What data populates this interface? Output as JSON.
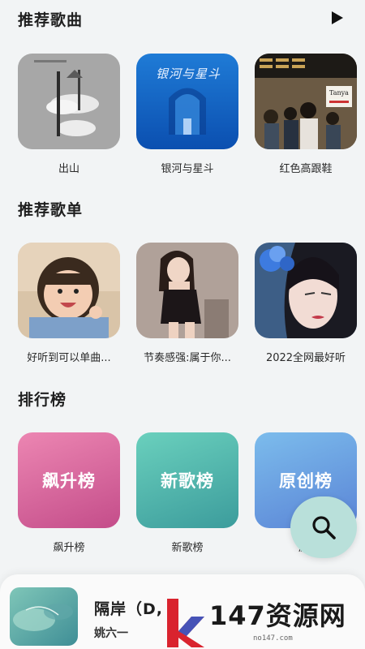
{
  "sections": {
    "songs": {
      "title": "推荐歌曲",
      "items": [
        {
          "label": "出山"
        },
        {
          "label": "银河与星斗",
          "cover_text": "银河与星斗"
        },
        {
          "label": "红色高跟鞋",
          "cover_text": "Tanya"
        }
      ]
    },
    "playlists": {
      "title": "推荐歌单",
      "items": [
        {
          "label": "好听到可以单曲..."
        },
        {
          "label": "节奏感强:属于你..."
        },
        {
          "label": "2022全网最好听"
        }
      ]
    },
    "charts": {
      "title": "排行榜",
      "items": [
        {
          "cover_text": "飙升榜",
          "label": "飙升榜",
          "colors": [
            "#e67aa6",
            "#c94f8c"
          ]
        },
        {
          "cover_text": "新歌榜",
          "label": "新歌榜",
          "colors": [
            "#5fc9b8",
            "#3a9c9a"
          ]
        },
        {
          "cover_text": "原创榜",
          "label": "原",
          "colors": [
            "#74b4e8",
            "#5a86d6"
          ]
        }
      ]
    }
  },
  "icons": {
    "play_all": "play-icon",
    "search": "search-icon"
  },
  "player": {
    "title": "隔岸（D,",
    "artist": "姚六一"
  },
  "watermark": {
    "brand": "147资源网",
    "url": "no147.com"
  },
  "colors": {
    "background": "#f2f4f5",
    "fab": "#b9e0da",
    "accent_red": "#d9232e"
  }
}
